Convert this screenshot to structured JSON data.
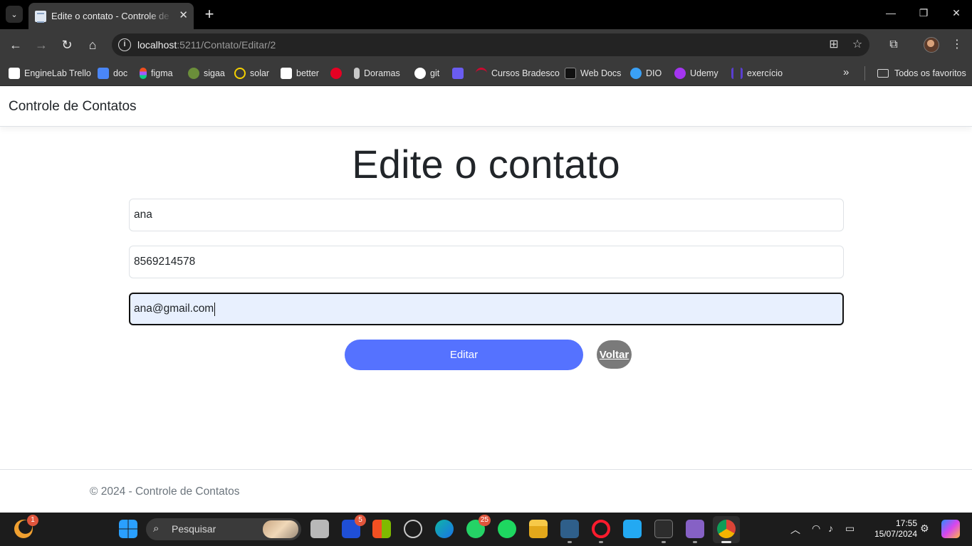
{
  "browser": {
    "tab_title": "Edite o contato - Controle de Contatos",
    "tab_close": "✕",
    "new_tab": "+",
    "url_host": "localhost",
    "url_path": ":5211/Contato/Editar/2",
    "bookmarks": [
      {
        "label": "EngineLab Trello",
        "color": "#ffffff"
      },
      {
        "label": "doc",
        "color": "#4a86f7"
      },
      {
        "label": "figma",
        "color": "#f24e1e"
      },
      {
        "label": "sigaa",
        "color": "#6b8e3a"
      },
      {
        "label": "solar",
        "color": "#f5d000"
      },
      {
        "label": "better",
        "color": "#ffffff"
      },
      {
        "label": "",
        "color": "#e60023"
      },
      {
        "label": "Doramas",
        "color": "#c8c8c8"
      },
      {
        "label": "git",
        "color": "#ffffff"
      },
      {
        "label": "",
        "color": "#6a5cf0"
      },
      {
        "label": "Cursos Bradesco",
        "color": "#cc092f"
      },
      {
        "label": "Web Docs",
        "color": "#111111"
      },
      {
        "label": "DIO",
        "color": "#3aa0f5"
      },
      {
        "label": "Udemy",
        "color": "#a435f0"
      },
      {
        "label": "exercício",
        "color": "#5a3fd0"
      }
    ],
    "all_bookmarks_label": "Todos os favoritos"
  },
  "site": {
    "brand": "Controle de Contatos",
    "heading": "Edite o contato",
    "form": {
      "name_value": "ana",
      "phone_value": "8569214578",
      "email_value": "ana@gmail.com"
    },
    "buttons": {
      "submit_label": "Editar",
      "back_label": "Voltar"
    },
    "footer": "© 2024 - Controle de Contatos"
  },
  "taskbar": {
    "search_placeholder": "Pesquisar",
    "badges": {
      "moon": "1",
      "lumen": "5",
      "whatsapp": "25"
    },
    "time": "17:55",
    "date": "15/07/2024"
  },
  "colors": {
    "accent_button": "#5572ff",
    "back_button": "#7a7a7a",
    "focused_field": "#e8f0fe"
  }
}
